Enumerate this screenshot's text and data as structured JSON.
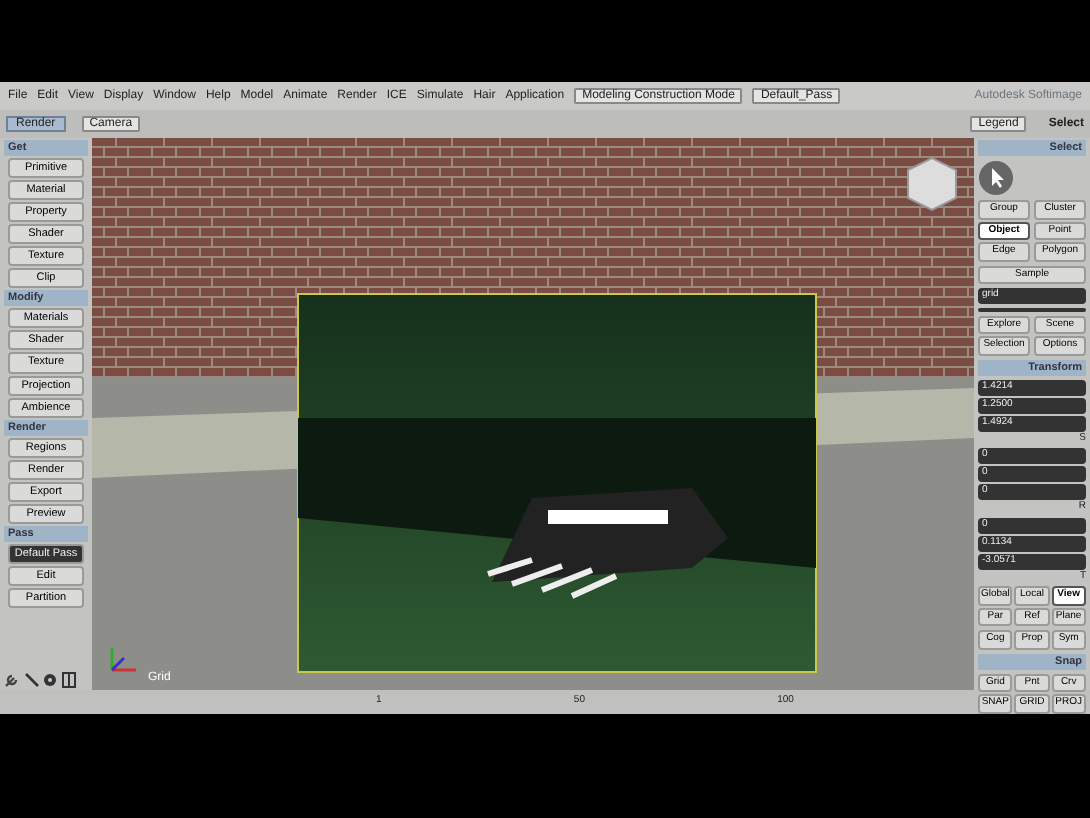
{
  "menu_bar": {
    "items": [
      "File",
      "Edit",
      "View",
      "Display",
      "Window",
      "Help",
      "Model",
      "Animate",
      "Render",
      "ICE",
      "Simulate",
      "Hair",
      "Application"
    ],
    "mode_dropdown": "Modeling Construction Mode",
    "pass_dropdown": "Default_Pass",
    "app_title": "Autodesk Softimage"
  },
  "toolbar": {
    "toolbar_dropdown": "Render",
    "camera_dropdown": "Camera",
    "legend": "Legend",
    "select_label": "Select"
  },
  "left_panel": {
    "sections": [
      {
        "title": "Get",
        "buttons": [
          {
            "label": "Primitive",
            "selected": false
          },
          {
            "label": "Material",
            "selected": false
          },
          {
            "label": "Property",
            "selected": false
          },
          {
            "label": "Shader",
            "selected": false
          },
          {
            "label": "Texture",
            "selected": false
          },
          {
            "label": "Clip",
            "selected": false
          }
        ]
      },
      {
        "title": "Modify",
        "buttons": [
          {
            "label": "Materials",
            "selected": false
          },
          {
            "label": "Shader",
            "selected": false
          },
          {
            "label": "Texture",
            "selected": false
          },
          {
            "label": "Projection",
            "selected": false
          },
          {
            "label": "Ambience",
            "selected": false
          }
        ]
      },
      {
        "title": "Render",
        "buttons": [
          {
            "label": "Regions",
            "selected": false
          },
          {
            "label": "Render",
            "selected": false
          },
          {
            "label": "Export",
            "selected": false
          },
          {
            "label": "Preview",
            "selected": false
          }
        ]
      },
      {
        "title": "Pass",
        "buttons": [
          {
            "label": "Default Pass",
            "selected": true
          },
          {
            "label": "Edit",
            "selected": false
          },
          {
            "label": "Partition",
            "selected": false
          }
        ]
      }
    ]
  },
  "viewport": {
    "corner_label": "Grid"
  },
  "right_panel": {
    "select_title": "Select",
    "select_buttons": [
      {
        "label": "Group",
        "selected": false
      },
      {
        "label": "Cluster",
        "selected": false
      },
      {
        "label": "Object",
        "selected": true
      },
      {
        "label": "Point",
        "selected": false
      },
      {
        "label": "Edge",
        "selected": false
      },
      {
        "label": "Polygon",
        "selected": false
      }
    ],
    "sample": "Sample",
    "name_field": "grid",
    "explore_buttons": [
      "Explore",
      "Scene",
      "Selection",
      "Options"
    ],
    "transform_title": "Transform",
    "transform_groups": [
      {
        "label": "S",
        "values": [
          "1.4214",
          "1.2500",
          "1.4924"
        ]
      },
      {
        "label": "R",
        "values": [
          "0",
          "0",
          "0"
        ]
      },
      {
        "label": "T",
        "values": [
          "0",
          "0.1134",
          "-3.0571"
        ]
      }
    ],
    "ref_buttons": [
      {
        "label": "Global",
        "selected": false
      },
      {
        "label": "Local",
        "selected": false
      },
      {
        "label": "View",
        "selected": true
      },
      {
        "label": "Par",
        "selected": false
      },
      {
        "label": "Ref",
        "selected": false
      },
      {
        "label": "Plane",
        "selected": false
      }
    ],
    "mode_buttons": [
      "Cog",
      "Prop",
      "Sym"
    ],
    "snap_title": "Snap",
    "snap_buttons": [
      "Grid",
      "Pnt",
      "Crv",
      "SNAP",
      "GRID",
      "PROJ"
    ]
  },
  "timeline": {
    "ticks": [
      "1",
      "50",
      "100"
    ]
  }
}
